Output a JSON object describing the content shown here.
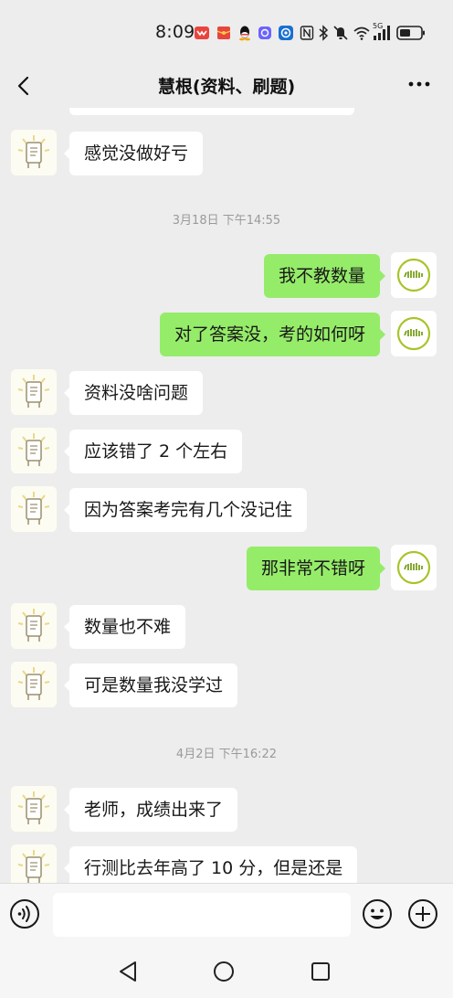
{
  "status_bar": {
    "time": "8:09",
    "network": "5G",
    "icons": [
      "notification-app-icon",
      "red-packet-icon",
      "qq-icon",
      "app-icon",
      "nfc-icon",
      "bluetooth-icon",
      "mute-icon",
      "wifi-icon",
      "signal-icon",
      "battery-icon"
    ]
  },
  "nav": {
    "title": "慧根(资料、刷题)",
    "back_icon": "chevron-left-icon",
    "more_icon": "more-dots-icon"
  },
  "messages": [
    {
      "id": "m1",
      "side": "left",
      "text": "感觉没做好亏"
    },
    {
      "id": "t1",
      "type": "timestamp",
      "text": "3月18日 下午14:55"
    },
    {
      "id": "m2",
      "side": "right",
      "text": "我不教数量"
    },
    {
      "id": "m3",
      "side": "right",
      "text": "对了答案没，考的如何呀"
    },
    {
      "id": "m4",
      "side": "left",
      "text": "资料没啥问题"
    },
    {
      "id": "m5",
      "side": "left",
      "text": "应该错了 2 个左右"
    },
    {
      "id": "m6",
      "side": "left",
      "text": "因为答案考完有几个没记住"
    },
    {
      "id": "m7",
      "side": "right",
      "text": "那非常不错呀"
    },
    {
      "id": "m8",
      "side": "left",
      "text": "数量也不难"
    },
    {
      "id": "m9",
      "side": "left",
      "text": "可是数量我没学过"
    },
    {
      "id": "t2",
      "type": "timestamp",
      "text": "4月2日 下午16:22"
    },
    {
      "id": "m10",
      "side": "left",
      "text": "老师，成绩出来了"
    },
    {
      "id": "m11",
      "side": "left",
      "text": "行测比去年高了 10 分，但是还是"
    }
  ],
  "input_bar": {
    "voice_icon": "voice-icon",
    "input_value": "",
    "emoji_icon": "emoji-icon",
    "plus_icon": "plus-icon"
  },
  "system_nav": {
    "back_icon": "triangle-back-icon",
    "home_icon": "circle-home-icon",
    "recent_icon": "square-recent-icon"
  },
  "colors": {
    "background": "#ededed",
    "bubble_self": "#95ec69",
    "bubble_other": "#ffffff",
    "timestamp": "#9a9a9a"
  }
}
